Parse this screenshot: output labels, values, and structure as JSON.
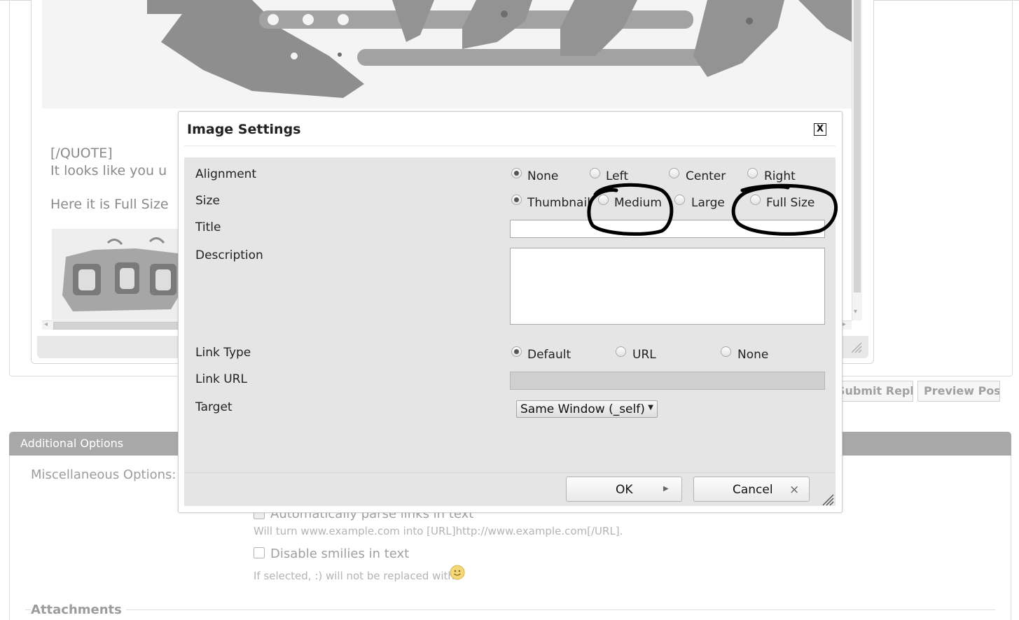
{
  "editor": {
    "quote_close": "[/QUOTE]",
    "text_line1": "It looks like you u",
    "text_line2": "Here it is Full Size",
    "scroll_left": "◂",
    "scroll_right": "▸",
    "scroll_down": "▾"
  },
  "page_buttons": {
    "submit_reply": "Submit Reply",
    "preview_post": "Preview Post"
  },
  "additional_options": {
    "title": "Additional Options",
    "misc_label": "Miscellaneous Options:",
    "parse_links_label": "Automatically parse links in text",
    "parse_links_help": "Will turn www.example.com into [URL]http://www.example.com[/URL].",
    "disable_smilies_label": "Disable smilies in text",
    "disable_smilies_help": "If selected, :) will not be replaced with",
    "attachments_label": "Attachments"
  },
  "dialog": {
    "title": "Image Settings",
    "close_label": "X",
    "alignment": {
      "label": "Alignment",
      "options": [
        "None",
        "Left",
        "Center",
        "Right"
      ],
      "selected": "None"
    },
    "size": {
      "label": "Size",
      "options": [
        "Thumbnail",
        "Medium",
        "Large",
        "Full Size"
      ],
      "selected": "Thumbnail"
    },
    "title_field": {
      "label": "Title",
      "value": ""
    },
    "description_field": {
      "label": "Description",
      "value": ""
    },
    "link_type": {
      "label": "Link Type",
      "options": [
        "Default",
        "URL",
        "None"
      ],
      "selected": "Default"
    },
    "link_url": {
      "label": "Link URL",
      "value": ""
    },
    "target": {
      "label": "Target",
      "value": "Same Window (_self)"
    },
    "ok_label": "OK",
    "cancel_label": "Cancel"
  },
  "colors": {
    "dialog_panel": "#e5e5e5",
    "section_bar": "#a8a8a8",
    "annotation_ink": "#000000"
  }
}
